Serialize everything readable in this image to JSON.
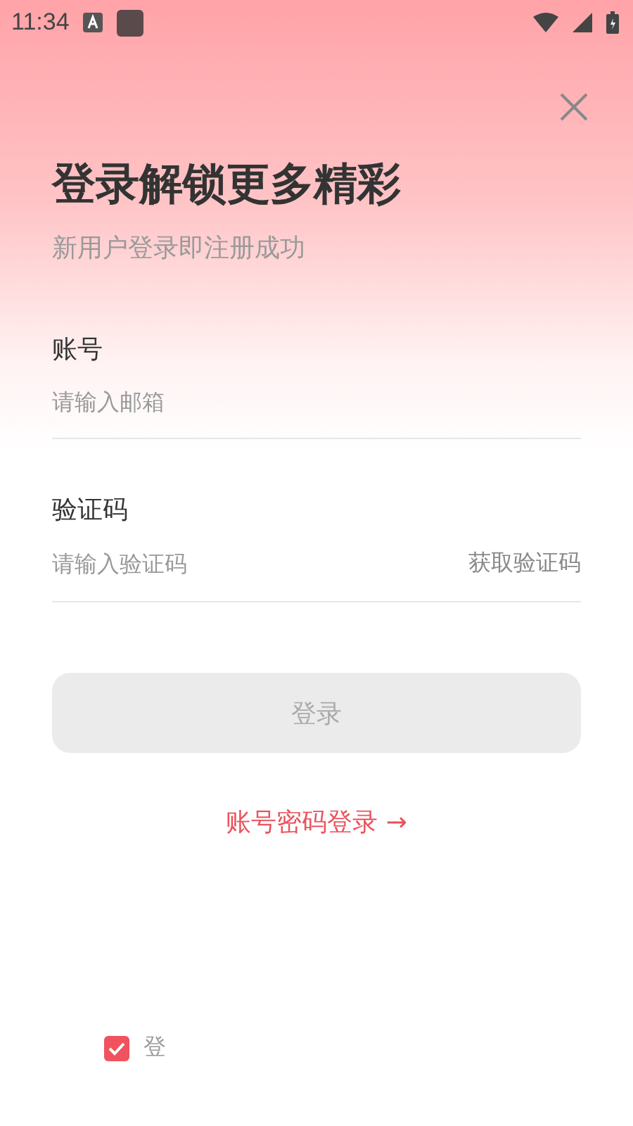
{
  "status_bar": {
    "time": "11:34"
  },
  "title": "登录解锁更多精彩",
  "subtitle": "新用户登录即注册成功",
  "fields": [
    {
      "label": "账号",
      "placeholder": "请输入邮箱"
    },
    {
      "label": "验证码",
      "placeholder": "请输入验证码",
      "action": "获取验证码"
    }
  ],
  "login_button": {
    "label": "登录",
    "disabled": true
  },
  "password_login_link": "账号密码登录 →",
  "agreement": {
    "checked": true,
    "text": "登"
  }
}
